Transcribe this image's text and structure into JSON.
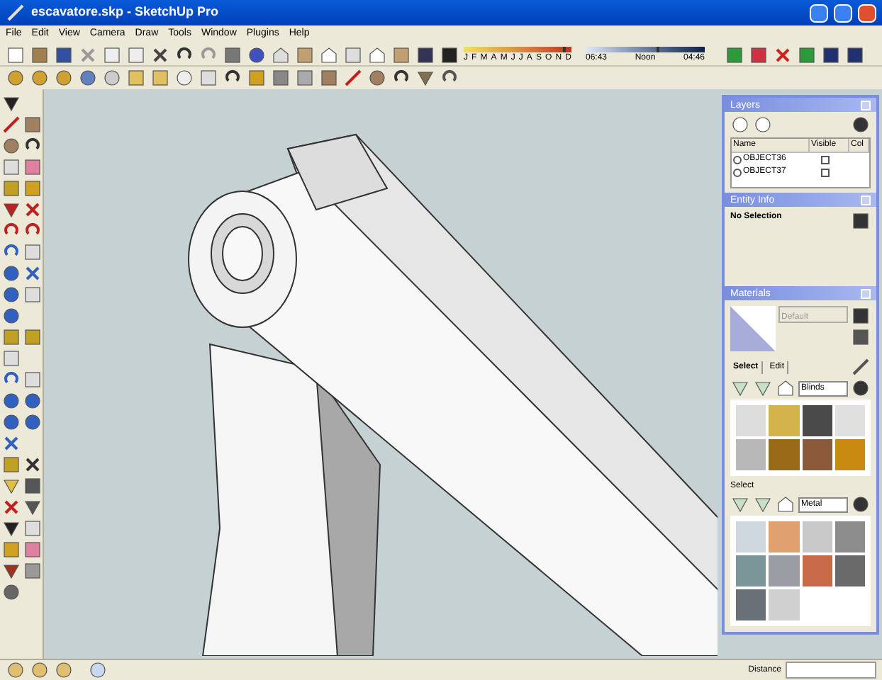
{
  "window": {
    "title": "escavatore.skp - SketchUp Pro"
  },
  "menu": [
    "File",
    "Edit",
    "View",
    "Camera",
    "Draw",
    "Tools",
    "Window",
    "Plugins",
    "Help"
  ],
  "shadow_settings": {
    "months": [
      "J",
      "F",
      "M",
      "A",
      "M",
      "J",
      "J",
      "A",
      "S",
      "O",
      "N",
      "D"
    ],
    "month_slider": {
      "level": 0.92
    },
    "time_slider": {
      "level": 0.6
    },
    "time_start": "06:43",
    "time_mid": "Noon",
    "time_end": "04:46"
  },
  "layers_panel": {
    "title": "Layers",
    "columns": [
      "Name",
      "Visible",
      "Col"
    ],
    "rows": [
      {
        "name": "OBJECT36",
        "selected": false,
        "visible": false
      },
      {
        "name": "OBJECT37",
        "selected": false,
        "visible": false
      }
    ]
  },
  "entity_info": {
    "title": "Entity Info",
    "text": "No Selection"
  },
  "materials": {
    "title": "Materials",
    "current": "Default",
    "tabs": [
      {
        "label": "Select",
        "selected": true
      },
      {
        "label": "Edit",
        "selected": false
      }
    ],
    "library": "Blinds",
    "swatches": [
      {
        "color": "#dcdcdc"
      },
      {
        "color": "#d4b44a"
      },
      {
        "color": "#4a4a4a"
      },
      {
        "color": "#e0e0e0"
      },
      {
        "color": "#b8b8b8"
      },
      {
        "color": "#9a6a18"
      },
      {
        "color": "#8a5a3a"
      },
      {
        "color": "#c88a10"
      }
    ],
    "second_label": "Select",
    "second_library": "Metal",
    "second_swatches": [
      {
        "color": "#cfd8de"
      },
      {
        "color": "#e0a070"
      },
      {
        "color": "#c8c8c8"
      },
      {
        "color": "#8c8c8c"
      },
      {
        "color": "#7a9698"
      },
      {
        "color": "#9a9ea4"
      },
      {
        "color": "#c86a4a"
      },
      {
        "color": "#6a6a6a"
      },
      {
        "color": "#6a7078"
      },
      {
        "color": "#d0d0d0"
      }
    ]
  },
  "status_bar": {
    "label": "Distance"
  }
}
